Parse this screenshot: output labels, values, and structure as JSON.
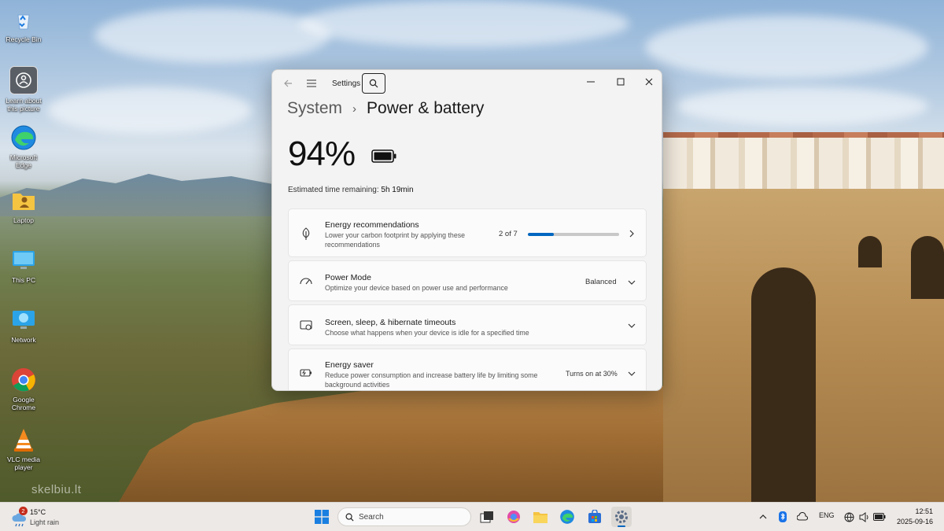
{
  "desktop": {
    "icons": [
      {
        "label": "Recycle Bin",
        "icon": "recycle-bin-icon"
      },
      {
        "label": "Learn about this picture",
        "icon": "learn-picture-icon"
      },
      {
        "label": "Microsoft Edge",
        "icon": "edge-icon"
      },
      {
        "label": "Laptop",
        "icon": "user-folder-icon"
      },
      {
        "label": "This PC",
        "icon": "this-pc-icon"
      },
      {
        "label": "Network",
        "icon": "network-icon"
      },
      {
        "label": "Google Chrome",
        "icon": "chrome-icon"
      },
      {
        "label": "VLC media player",
        "icon": "vlc-icon"
      }
    ],
    "watermark": "skelbiu.lt"
  },
  "window": {
    "app_title": "Settings",
    "breadcrumb_parent": "System",
    "breadcrumb_separator": "›",
    "page_title": "Power & battery",
    "battery_percent": "94%",
    "estimate_label": "Estimated time remaining:",
    "estimate_value": "5h 19min",
    "cards": {
      "energy_recs": {
        "title": "Energy recommendations",
        "desc": "Lower your carbon footprint by applying these recommendations",
        "value": "2 of 7",
        "progress_fraction": 0.2857
      },
      "power_mode": {
        "title": "Power Mode",
        "desc": "Optimize your device based on power use and performance",
        "value": "Balanced"
      },
      "screen_sleep": {
        "title": "Screen, sleep, & hibernate timeouts",
        "desc": "Choose what happens when your device is idle for a specified time"
      },
      "energy_saver": {
        "title": "Energy saver",
        "desc": "Reduce power consumption and increase battery life by limiting some background activities",
        "value": "Turns on at 30%"
      }
    }
  },
  "taskbar": {
    "weather": {
      "badge": "2",
      "temp": "15°C",
      "condition": "Light rain"
    },
    "search_placeholder": "Search",
    "tray": {
      "language": "ENG"
    },
    "clock": {
      "time": "12:51",
      "date": "2025-09-16"
    },
    "accent_color": "#0067c0"
  }
}
